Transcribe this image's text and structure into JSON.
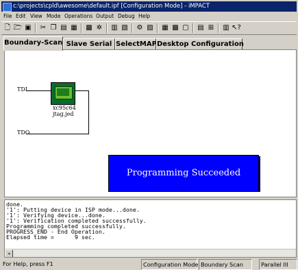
{
  "window": {
    "title": "c:\\projects\\cpld\\awesome\\default.ipf [Configuration Mode] - iMPACT"
  },
  "menu": [
    "File",
    "Edit",
    "View",
    "Mode",
    "Operations",
    "Output",
    "Debug",
    "Help"
  ],
  "tabs": [
    {
      "label": "Boundary-Scan",
      "active": true
    },
    {
      "label": "Slave Serial",
      "active": false
    },
    {
      "label": "SelectMAP",
      "active": false
    },
    {
      "label": "Desktop Configuration",
      "active": false
    }
  ],
  "chain": {
    "tdi_label": "TDI",
    "tdo_label": "TDO",
    "device_name": "xc95c64",
    "device_file": "jtag.jed"
  },
  "banner": {
    "text": "Programming Succeeded",
    "bg_color": "#0000ff",
    "text_color": "#ffffff"
  },
  "log_lines": [
    "done.",
    "'1': Putting device in ISP mode...done.",
    "'1': Verifying device...done.",
    "'1': Verification completed successfully.",
    "Programming completed successfully.",
    "PROGRESS_END - End Operation.",
    "Elapsed time =      9 sec."
  ],
  "status": {
    "help": "For Help, press F1",
    "mode": "Configuration Mode",
    "scan": "Boundary Scan",
    "cable": "Parallel III"
  },
  "colors": {
    "titlebar": "#0a246a",
    "chip": "#0a6b2e"
  }
}
